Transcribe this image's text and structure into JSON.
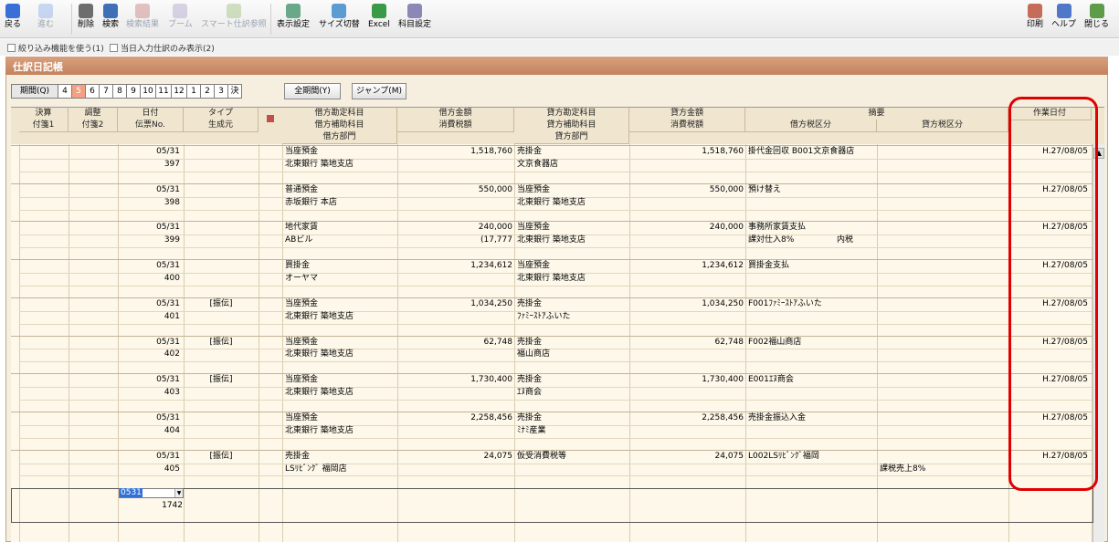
{
  "toolbar": {
    "items": [
      {
        "label": "戻る",
        "icon": "back-arrow-icon",
        "enabled": true
      },
      {
        "label": "進む",
        "icon": "forward-arrow-icon",
        "enabled": false
      },
      {
        "label": "削除",
        "icon": "trash-icon",
        "enabled": true
      },
      {
        "label": "検索",
        "icon": "search-icon",
        "enabled": true
      },
      {
        "label": "検索結果",
        "icon": "search-result-icon",
        "enabled": false
      },
      {
        "label": "ブーム",
        "icon": "boom-icon",
        "enabled": false
      },
      {
        "label": "スマート仕訳参照",
        "icon": "smart-journal-icon",
        "enabled": false
      },
      {
        "label": "表示設定",
        "icon": "display-settings-icon",
        "enabled": true
      },
      {
        "label": "サイズ切替",
        "icon": "size-switch-icon",
        "enabled": true
      },
      {
        "label": "Excel",
        "icon": "excel-icon",
        "enabled": true
      },
      {
        "label": "科目設定",
        "icon": "account-settings-icon",
        "enabled": true
      }
    ],
    "right_items": [
      {
        "label": "印刷",
        "icon": "print-icon"
      },
      {
        "label": "ヘルプ",
        "icon": "help-icon"
      },
      {
        "label": "閉じる",
        "icon": "close-door-icon"
      }
    ]
  },
  "options": {
    "filter_label": "絞り込み機能を使う(1)",
    "today_only_label": "当日入力仕訳のみ表示(2)"
  },
  "window": {
    "title": "仕訳日記帳"
  },
  "period": {
    "label": "期間(Q)",
    "months": [
      "4",
      "5",
      "6",
      "7",
      "8",
      "9",
      "10",
      "11",
      "12",
      "1",
      "2",
      "3",
      "決"
    ],
    "selected_month": "5",
    "all_period_label": "全期間(Y)",
    "jump_label": "ジャンプ(M)"
  },
  "columns": {
    "kessan": "決算",
    "fusen1": "付箋1",
    "chosei": "調整",
    "fusen2": "付箋2",
    "date": "日付",
    "voucher": "伝票No.",
    "type": "タイプ",
    "source": "生成元",
    "debit_account": "借方勘定科目",
    "debit_sub": "借方補助科目",
    "debit_dept": "借方部門",
    "debit_amount": "借方金額",
    "tax_amount": "消費税額",
    "credit_account": "貸方勘定科目",
    "credit_sub": "貸方補助科目",
    "credit_dept": "貸方部門",
    "credit_amount": "貸方金額",
    "credit_tax": "消費税額",
    "summary": "摘要",
    "debit_tax_class": "借方税区分",
    "credit_tax_class": "貸方税区分",
    "work_date": "作業日付"
  },
  "entries": [
    {
      "date": "05/31",
      "no": "397",
      "type": "",
      "debit_account": "当座預金",
      "debit_sub": "北東銀行 築地支店",
      "debit_amount": "1,518,760",
      "debit_tax": "",
      "credit_account": "売掛金",
      "credit_sub": "文京食器店",
      "credit_amount": "1,518,760",
      "summary": "掛代金回収 B001文京食器店",
      "debit_tax_class": "",
      "debit_tax_note": "",
      "credit_tax_class": "",
      "work_date": "H.27/08/05"
    },
    {
      "date": "05/31",
      "no": "398",
      "type": "",
      "debit_account": "普通預金",
      "debit_sub": "赤坂銀行 本店",
      "debit_amount": "550,000",
      "debit_tax": "",
      "credit_account": "当座預金",
      "credit_sub": "北東銀行 築地支店",
      "credit_amount": "550,000",
      "summary": "預け替え",
      "debit_tax_class": "",
      "debit_tax_note": "",
      "credit_tax_class": "",
      "work_date": "H.27/08/05"
    },
    {
      "date": "05/31",
      "no": "399",
      "type": "",
      "debit_account": "地代家賃",
      "debit_sub": "ABビル",
      "debit_amount": "240,000",
      "debit_tax": "(17,777",
      "credit_account": "当座預金",
      "credit_sub": "北東銀行 築地支店",
      "credit_amount": "240,000",
      "summary": "事務所家賃支払",
      "debit_tax_class": "課対仕入8%",
      "debit_tax_note": "内税",
      "credit_tax_class": "",
      "work_date": "H.27/08/05"
    },
    {
      "date": "05/31",
      "no": "400",
      "type": "",
      "debit_account": "買掛金",
      "debit_sub": "オーヤマ",
      "debit_amount": "1,234,612",
      "debit_tax": "",
      "credit_account": "当座預金",
      "credit_sub": "北東銀行 築地支店",
      "credit_amount": "1,234,612",
      "summary": "買掛金支払",
      "debit_tax_class": "",
      "debit_tax_note": "",
      "credit_tax_class": "",
      "work_date": "H.27/08/05"
    },
    {
      "date": "05/31",
      "no": "401",
      "type": "[振伝]",
      "debit_account": "当座預金",
      "debit_sub": "北東銀行 築地支店",
      "debit_amount": "1,034,250",
      "debit_tax": "",
      "credit_account": "売掛金",
      "credit_sub": "ﾌｧﾐｰｽﾄｱふいた",
      "credit_amount": "1,034,250",
      "summary": "F001ﾌｧﾐｰｽﾄｱふいた",
      "debit_tax_class": "",
      "debit_tax_note": "",
      "credit_tax_class": "",
      "work_date": "H.27/08/05"
    },
    {
      "date": "05/31",
      "no": "402",
      "type": "[振伝]",
      "debit_account": "当座預金",
      "debit_sub": "北東銀行 築地支店",
      "debit_amount": "62,748",
      "debit_tax": "",
      "credit_account": "売掛金",
      "credit_sub": "福山商店",
      "credit_amount": "62,748",
      "summary": "F002福山商店",
      "debit_tax_class": "",
      "debit_tax_note": "",
      "credit_tax_class": "",
      "work_date": "H.27/08/05"
    },
    {
      "date": "05/31",
      "no": "403",
      "type": "[振伝]",
      "debit_account": "当座預金",
      "debit_sub": "北東銀行 築地支店",
      "debit_amount": "1,730,400",
      "debit_tax": "",
      "credit_account": "売掛金",
      "credit_sub": "ｴﾇ商会",
      "credit_amount": "1,730,400",
      "summary": "E001ｴﾇ商会",
      "debit_tax_class": "",
      "debit_tax_note": "",
      "credit_tax_class": "",
      "work_date": "H.27/08/05"
    },
    {
      "date": "05/31",
      "no": "404",
      "type": "",
      "debit_account": "当座預金",
      "debit_sub": "北東銀行 築地支店",
      "debit_amount": "2,258,456",
      "debit_tax": "",
      "credit_account": "売掛金",
      "credit_sub": "ﾐﾅﾐ産業",
      "credit_amount": "2,258,456",
      "summary": "売掛金振込入金",
      "debit_tax_class": "",
      "debit_tax_note": "",
      "credit_tax_class": "",
      "work_date": "H.27/08/05"
    },
    {
      "date": "05/31",
      "no": "405",
      "type": "[振伝]",
      "debit_account": "売掛金",
      "debit_sub": "LSﾘﾋﾞﾝｸﾞ 福岡店",
      "debit_amount": "24,075",
      "debit_tax": "",
      "credit_account": "仮受消費税等",
      "credit_sub": "",
      "credit_amount": "24,075",
      "summary": "L002LSﾘﾋﾞﾝｸﾞ福岡",
      "debit_tax_class": "",
      "debit_tax_note": "",
      "credit_tax_class": "課税売上8%",
      "work_date": "H.27/08/05"
    }
  ],
  "new_entry": {
    "date_value": "0531",
    "voucher_no": "1742"
  },
  "colors": {
    "title_bar": "#c98a64",
    "grid_bg": "#fdf8ea",
    "selected_month": "#f3a083",
    "highlight": "#e00000"
  }
}
